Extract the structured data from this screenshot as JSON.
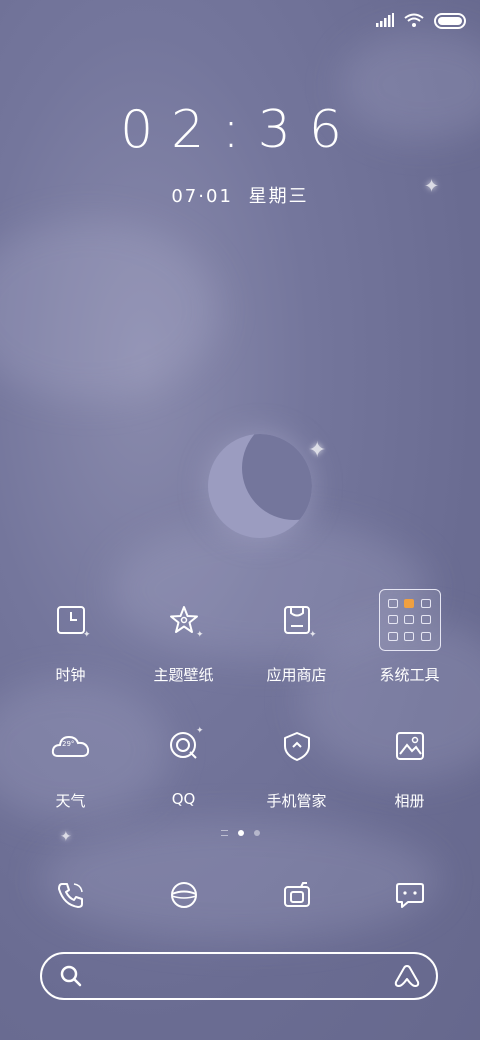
{
  "clock": {
    "time": "02:36",
    "date": "07·01",
    "weekday": "星期三"
  },
  "apps_row1": [
    {
      "label": "时钟",
      "icon": "clock-icon"
    },
    {
      "label": "主题壁纸",
      "icon": "theme-star-icon"
    },
    {
      "label": "应用商店",
      "icon": "app-store-bag-icon"
    },
    {
      "label": "系统工具",
      "icon": "folder-icon"
    }
  ],
  "apps_row2": [
    {
      "label": "天气",
      "icon": "weather-cloud-icon",
      "temp": "29°"
    },
    {
      "label": "QQ",
      "icon": "qq-icon"
    },
    {
      "label": "手机管家",
      "icon": "security-shield-icon"
    },
    {
      "label": "相册",
      "icon": "gallery-icon"
    }
  ],
  "dock": [
    {
      "icon": "phone-icon"
    },
    {
      "icon": "browser-icon"
    },
    {
      "icon": "camera-icon"
    },
    {
      "icon": "messages-icon"
    }
  ],
  "pager": {
    "pages": 3,
    "active": 2
  },
  "colors": {
    "background": "#74769c",
    "accent": "#f0a040",
    "text": "#ffffff"
  }
}
